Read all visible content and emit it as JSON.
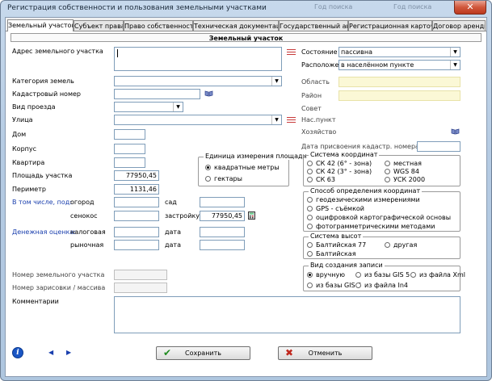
{
  "window": {
    "title": "Регистрация собственности и пользования земельными участками",
    "bg_text_1": "Год поиска",
    "bg_text_2": "Год поиска",
    "close_glyph": "✕"
  },
  "tabs": [
    {
      "label": "Земельный участок",
      "active": true
    },
    {
      "label": "Субъект права"
    },
    {
      "label": "Право собственности"
    },
    {
      "label": "Техническая документация"
    },
    {
      "label": "Государственный акт"
    },
    {
      "label": "Регистрационная карточка"
    },
    {
      "label": "Договор аренды"
    }
  ],
  "section_title": "Земельный участок",
  "left": {
    "address_label": "Адрес земельного участка",
    "category_label": "Категория земель",
    "cadastral_label": "Кадастровый номер",
    "entrance_label": "Вид проезда",
    "street_label": "Улица",
    "house_label": "Дом",
    "building_label": "Корпус",
    "apartment_label": "Квартира",
    "area_label": "Площадь участка",
    "area_value": "77950,45",
    "perimeter_label": "Периметр",
    "perimeter_value": "1131,46",
    "including_label": "В том числе, под:",
    "garden_label": "огород",
    "orchard_label": "сад",
    "hayfield_label": "сенокос",
    "built_label": "застройку",
    "built_value": "77950,45",
    "money_label": "Денежная оценка:",
    "tax_label": "налоговая",
    "date1_label": "дата",
    "market_label": "рыночная",
    "date2_label": "дата",
    "plot_num_label": "Номер земельного участка",
    "sketch_label": "Номер зарисовки / массива",
    "comments_label": "Комментарии"
  },
  "units": {
    "legend": "Единица измерения площади",
    "options": [
      "квадратные метры",
      "гектары"
    ],
    "selected": 0
  },
  "right": {
    "state_label": "Состояние",
    "state_value": "пассивна",
    "location_label": "Расположение",
    "location_value": "в населённом пункте",
    "region_label": "Область",
    "district_label": "Район",
    "council_label": "Совет",
    "settlement_label": "Нас.пункт",
    "farm_label": "Хозяйство",
    "cad_date_label": "Дата присвоения кадастр. номера"
  },
  "coords": {
    "legend": "Система координат",
    "options": [
      "СК 42 (6° - зона)",
      "местная",
      "СК 42 (3° - зона)",
      "WGS 84",
      "СК 63",
      "УСК 2000"
    ]
  },
  "method": {
    "legend": "Способ определения координат",
    "options": [
      "геодезическими измерениями",
      "GPS - съёмкой",
      "оцифровкой картографической основы",
      "фотограмметрическими методами"
    ]
  },
  "heights": {
    "legend": "Система высот",
    "options": [
      "Балтийская 77",
      "другая",
      "Балтийская"
    ]
  },
  "record": {
    "legend": "Вид создания записи",
    "options": [
      "вручную",
      "из базы GIS 5",
      "из файла Xml",
      "из базы GIS 6",
      "из файла In4"
    ],
    "selected": 0
  },
  "footer": {
    "info_glyph": "i",
    "prev_glyph": "◀",
    "next_glyph": "▶",
    "save_label": "Сохранить",
    "save_glyph": "✔",
    "cancel_label": "Отменить",
    "cancel_glyph": "✖",
    "colors": {
      "save": "#1f8a1f",
      "cancel": "#c0281e"
    }
  }
}
